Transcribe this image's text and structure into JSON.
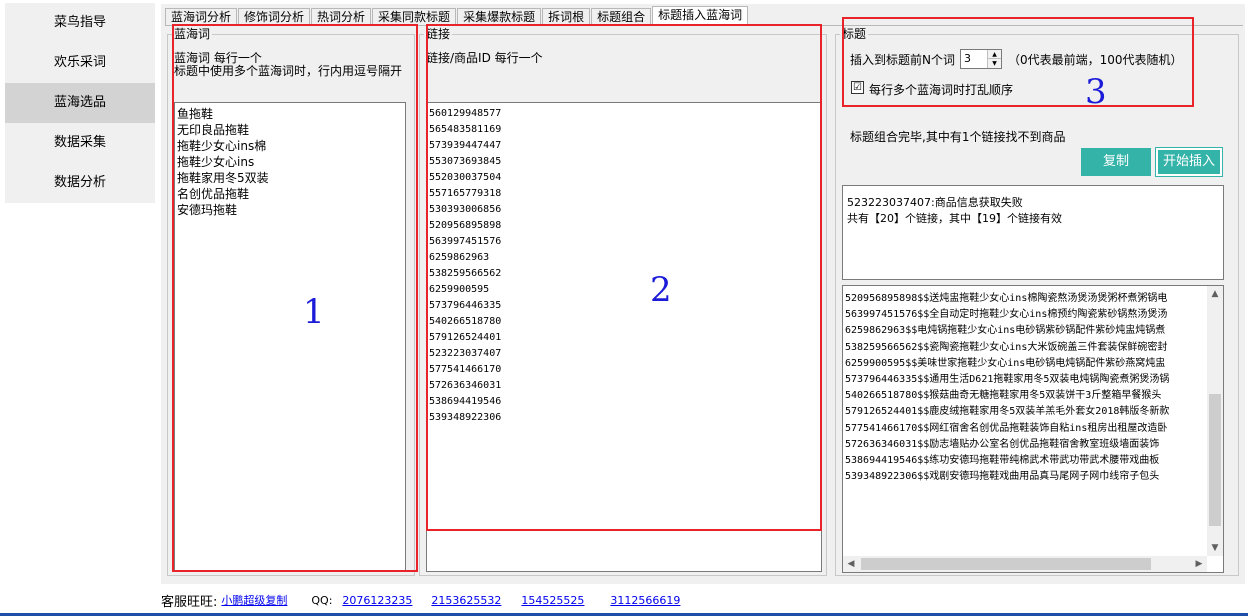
{
  "sidebar": {
    "items": [
      {
        "label": "菜鸟指导"
      },
      {
        "label": "欢乐采词"
      },
      {
        "label": "蓝海选品"
      },
      {
        "label": "数据采集"
      },
      {
        "label": "数据分析"
      }
    ]
  },
  "tabs": [
    {
      "label": "蓝海词分析"
    },
    {
      "label": "修饰词分析"
    },
    {
      "label": "热词分析"
    },
    {
      "label": "采集同款标题"
    },
    {
      "label": "采集爆款标题"
    },
    {
      "label": "拆词根"
    },
    {
      "label": "标题组合"
    },
    {
      "label": "标题插入蓝海词"
    }
  ],
  "blue_words": {
    "title": "蓝海词",
    "hint1": "蓝海词 每行一个",
    "hint2": "标题中使用多个蓝海词时，行内用逗号隔开",
    "lines": [
      "鱼拖鞋",
      "无印良品拖鞋",
      "拖鞋少女心ins棉",
      "拖鞋少女心ins",
      "拖鞋家用冬5双装",
      "名创优品拖鞋",
      "安德玛拖鞋"
    ]
  },
  "links": {
    "title": "链接",
    "hint": "链接/商品ID 每行一个",
    "lines": [
      "560129948577",
      "565483581169",
      "573939447447",
      "553073693845",
      "552030037504",
      "557165779318",
      "530393006856",
      "520956895898",
      "563997451576",
      "6259862963",
      "538259566562",
      "6259900595",
      "573796446335",
      "540266518780",
      "579126524401",
      "523223037407",
      "577541466170",
      "572636346031",
      "538694419546",
      "539348922306"
    ]
  },
  "title_group": {
    "title": "标题",
    "insert_label": "插入到标题前N个词",
    "insert_value": "3",
    "insert_note": "（0代表最前端，100代表随机）",
    "shuffle_label": "每行多个蓝海词时打乱顺序",
    "shuffle_checked": "☑",
    "status": "标题组合完毕,其中有1个链接找不到商品",
    "copy_button": "复制",
    "start_button": "开始插入"
  },
  "log": {
    "lines": [
      "523223037407:商品信息获取失败",
      "共有【20】个链接，其中【19】个链接有效"
    ]
  },
  "results": {
    "lines": [
      "520956895898$$送炖盅拖鞋少女心ins棉陶瓷熬汤煲汤煲粥杯煮粥锅电",
      "563997451576$$全自动定时拖鞋少女心ins棉预约陶瓷紫砂锅熬汤煲汤",
      "",
      "6259862963$$电炖锅拖鞋少女心ins电砂锅紫砂锅配件紫砂炖盅炖锅煮",
      "538259566562$$瓷陶瓷拖鞋少女心ins大米饭碗盖三件套装保鲜碗密封",
      "6259900595$$美味世家拖鞋少女心ins电砂锅电炖锅配件紫砂燕窝炖盅",
      "",
      "573796446335$$通用生活D621拖鞋家用冬5双装电炖锅陶瓷煮粥煲汤锅",
      "540266518780$$猴菇曲奇无糖拖鞋家用冬5双装饼干3斤整箱早餐猴头",
      "579126524401$$鹿皮绒拖鞋家用冬5双装羊羔毛外套女2018韩版冬新款",
      "",
      "577541466170$$网红宿舍名创优品拖鞋装饰自粘ins租房出租屋改造卧",
      "572636346031$$励志墙贴办公室名创优品拖鞋宿舍教室班级墙面装饰",
      "",
      "538694419546$$练功安德玛拖鞋带纯棉武术带武功带武术腰带戏曲板",
      "539348922306$$戏剧安德玛拖鞋戏曲用品真马尾网子网巾线帘子包头"
    ]
  },
  "annotations": [
    "1",
    "2",
    "3"
  ],
  "footer": {
    "service_label": "客服旺旺:",
    "service_name": "小鹏超级复制",
    "qq_label": "QQ:",
    "qq_numbers": [
      "2076123235",
      "2153625532",
      "154525525",
      "3112566619"
    ]
  },
  "colors": {
    "accent_button": "#34b3a8",
    "annotation_box": "#e8242a",
    "annotation_number": "#1b1bd8",
    "link": "#0000ee"
  }
}
